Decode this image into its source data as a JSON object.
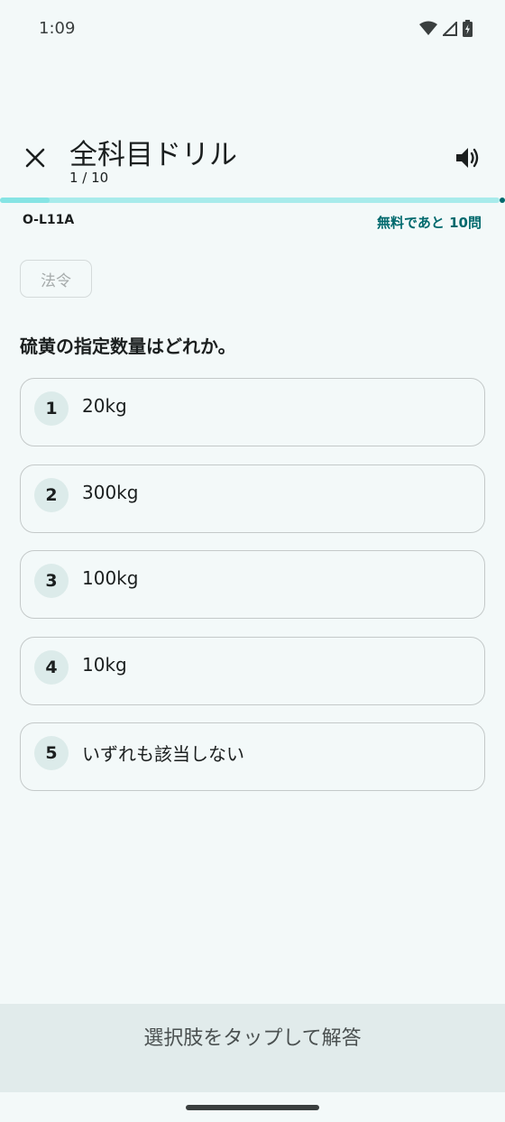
{
  "status_bar": {
    "time": "1:09",
    "icons": [
      "wifi-icon",
      "cellular-signal-icon",
      "battery-charging-icon"
    ]
  },
  "header": {
    "title": "全科目ドリル",
    "progress_label": "1 / 10",
    "close_icon": "close-icon",
    "volume_icon": "volume-icon"
  },
  "progress": {
    "current": 1,
    "total": 10,
    "fraction": 0.1
  },
  "meta": {
    "question_id": "O-L11A",
    "free_remaining": "無料であと 10問"
  },
  "category": {
    "label": "法令"
  },
  "question": {
    "text": "硫黄の指定数量はどれか。"
  },
  "choices": [
    {
      "number": "1",
      "text": "20kg"
    },
    {
      "number": "2",
      "text": "300kg"
    },
    {
      "number": "3",
      "text": "100kg"
    },
    {
      "number": "4",
      "text": "10kg"
    },
    {
      "number": "5",
      "text": "いずれも該当しない"
    }
  ],
  "footer": {
    "instruction": "選択肢をタップして解答"
  },
  "colors": {
    "accent": "#00696d",
    "progress": "#a8ebeb",
    "background": "#f3f9f9",
    "footer": "#e1ebeb"
  }
}
